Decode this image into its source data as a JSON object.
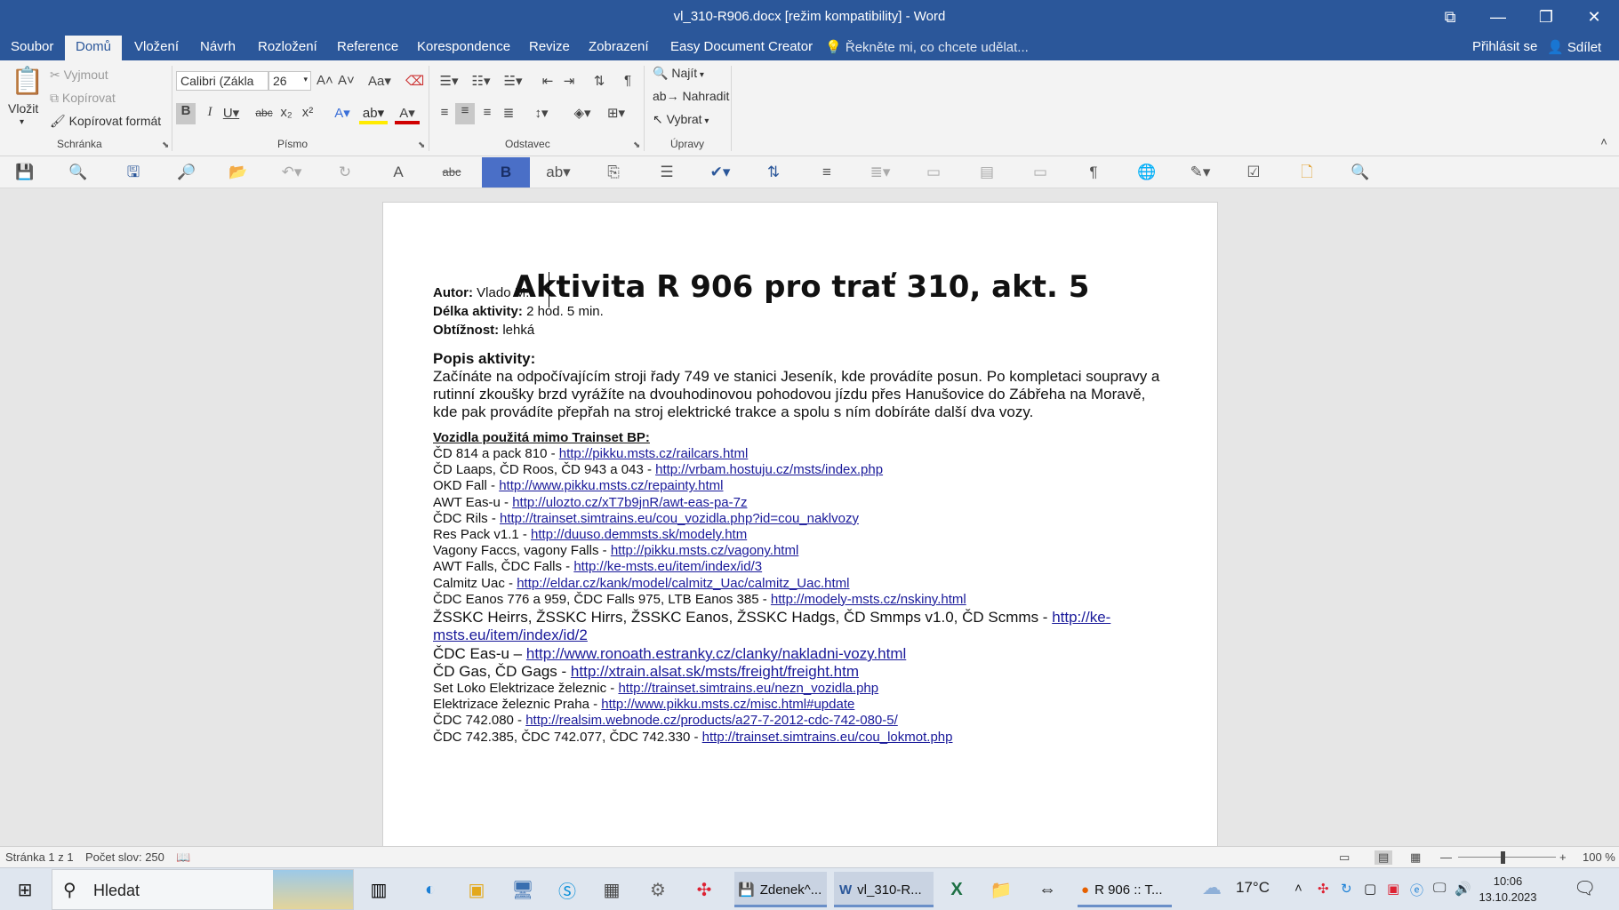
{
  "window": {
    "title": "vl_310-R906.docx [režim kompatibility] - Word",
    "controls": {
      "ribbon_display": "⧉",
      "minimize": "—",
      "restore": "❐",
      "close": "✕"
    }
  },
  "menu": {
    "tabs": [
      "Soubor",
      "Domů",
      "Vložení",
      "Návrh",
      "Rozložení",
      "Reference",
      "Korespondence",
      "Revize",
      "Zobrazení",
      "Easy Document Creator"
    ],
    "active": "Domů",
    "tell_me": "Řekněte mi, co chcete udělat...",
    "sign_in": "Přihlásit se",
    "share": "Sdílet"
  },
  "ribbon": {
    "clipboard": {
      "paste": "Vložit",
      "cut": "Vyjmout",
      "copy": "Kopírovat",
      "format_painter": "Kopírovat formát",
      "label": "Schránka"
    },
    "font": {
      "name": "Calibri (Zákla",
      "size": "26",
      "label": "Písmo"
    },
    "paragraph": {
      "label": "Odstavec"
    },
    "editing": {
      "find": "Najít",
      "replace": "Nahradit",
      "select": "Vybrat",
      "label": "Úpravy"
    }
  },
  "document": {
    "title": "Aktivita R 906 pro trať 310, akt. 5",
    "author_label": "Autor:",
    "author": "Vlado M.",
    "duration_label": "Délka aktivity:",
    "duration": "2 hod. 5 min.",
    "difficulty_label": "Obtížnost:",
    "difficulty": "lehká",
    "desc_heading": "Popis aktivity:",
    "description": "Začínáte na odpočívajícím stroji řady 749 ve stanici Jeseník, kde provádíte posun. Po kompletaci soupravy a rutinní zkoušky brzd vyrážíte na dvouhodinovou pohodovou jízdu přes Hanušovice do Zábřeha na Moravě, kde pak provádíte přepřah na stroj elektrické trakce a spolu s ním dobíráte další dva vozy.",
    "vehicles_heading": "Vozidla použitá mimo Trainset BP:",
    "vehicles": [
      {
        "text": "ČD 814 a pack 810 - ",
        "url": "http://pikku.msts.cz/railcars.html"
      },
      {
        "text": "ČD Laaps, ČD Roos, ČD 943 a 043 - ",
        "url": "http://vrbam.hostuju.cz/msts/index.php"
      },
      {
        "text": "OKD Fall - ",
        "url": "http://www.pikku.msts.cz/repainty.html"
      },
      {
        "text": "AWT Eas-u - ",
        "url": "http://ulozto.cz/xT7b9jnR/awt-eas-pa-7z"
      },
      {
        "text": "ČDC Rils - ",
        "url": "http://trainset.simtrains.eu/cou_vozidla.php?id=cou_naklvozy"
      },
      {
        "text": "Res Pack v1.1 - ",
        "url": "http://duuso.demmsts.sk/modely.htm"
      },
      {
        "text": "Vagony Faccs, vagony Falls - ",
        "url": "http://pikku.msts.cz/vagony.html"
      },
      {
        "text": "AWT Falls, ČDC Falls - ",
        "url": "http://ke-msts.eu/item/index/id/3"
      },
      {
        "text": "Calmitz Uac - ",
        "url": "http://eldar.cz/kank/model/calmitz_Uac/calmitz_Uac.html"
      },
      {
        "text": "ČDC Eanos 776 a 959, ČDC Falls 975, LTB Eanos 385 - ",
        "url": "http://modely-msts.cz/nskiny.html"
      }
    ],
    "vehicles_big": [
      {
        "text": "ŽSSKC Heirrs, ŽSSKC Hirrs, ŽSSKC Eanos, ŽSSKC Hadgs, ČD Smmps v1.0, ČD Scmms - ",
        "url": "http://ke-",
        "url2": "msts.eu/item/index/id/2"
      },
      {
        "text": "ČDC Eas-u – ",
        "url": "http://www.ronoath.estranky.cz/clanky/nakladni-vozy.html"
      },
      {
        "text": "ČD Gas, ČD Gags - ",
        "url": "http://xtrain.alsat.sk/msts/freight/freight.htm"
      }
    ],
    "vehicles_tail": [
      {
        "text": "Set Loko Elektrizace železnic - ",
        "url": "http://trainset.simtrains.eu/nezn_vozidla.php"
      },
      {
        "text": "Elektrizace železnic Praha - ",
        "url": "http://www.pikku.msts.cz/misc.html#update"
      },
      {
        "text": "ČDC 742.080 - ",
        "url": "http://realsim.webnode.cz/products/a27-7-2012-cdc-742-080-5/"
      },
      {
        "text": "ČDC 742.385, ČDC 742.077, ČDC 742.330 - ",
        "url": "http://trainset.simtrains.eu/cou_lokmot.php"
      }
    ]
  },
  "status": {
    "page": "Stránka 1 z 1",
    "words": "Počet slov: 250",
    "zoom": "100 %"
  },
  "taskbar": {
    "search": "Hledat",
    "apps": [
      "Zdenek^...",
      "vl_310-R...",
      "R 906 :: T..."
    ],
    "temperature": "17°C",
    "time": "10:06",
    "date": "13.10.2023"
  }
}
